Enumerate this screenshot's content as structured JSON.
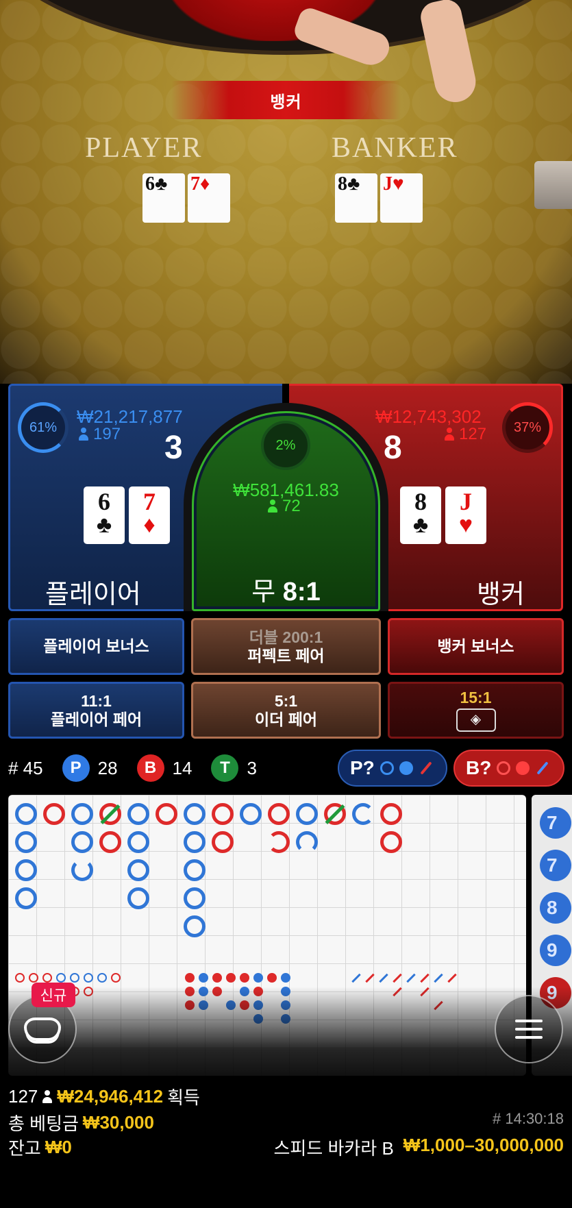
{
  "video": {
    "result_banner": "뱅커",
    "felt_player": "PLAYER",
    "felt_banker": "BANKER",
    "player_cards": [
      {
        "rank": "6",
        "suit": "♣",
        "color": "black"
      },
      {
        "rank": "7",
        "suit": "♦",
        "color": "red"
      }
    ],
    "banker_cards": [
      {
        "rank": "8",
        "suit": "♣",
        "color": "black"
      },
      {
        "rank": "J",
        "suit": "♥",
        "color": "red"
      }
    ]
  },
  "player": {
    "percent": "61%",
    "amount": "₩21,217,877",
    "bettors": "197",
    "score": "3",
    "label": "플레이어",
    "cards": [
      {
        "rank": "6",
        "suit": "♣"
      },
      {
        "rank": "7",
        "suit": "♦"
      }
    ]
  },
  "banker": {
    "percent": "37%",
    "amount": "₩12,743,302",
    "bettors": "127",
    "score": "8",
    "label": "뱅커",
    "cards": [
      {
        "rank": "8",
        "suit": "♣"
      },
      {
        "rank": "J",
        "suit": "♥"
      }
    ]
  },
  "tie": {
    "percent": "2%",
    "amount": "₩581,461.83",
    "bettors": "72",
    "label": "무",
    "odds": "8:1"
  },
  "side_bets": {
    "player_bonus": "플레이어 보너스",
    "perfect_pair_top": "더블 200:1",
    "perfect_pair_bottom": "퍼펙트 페어",
    "banker_bonus": "뱅커 보너스",
    "player_pair_odds": "11:1",
    "player_pair": "플레이어 페어",
    "either_pair_odds": "5:1",
    "either_pair": "이더 페어",
    "bonus_odds": "15:1"
  },
  "stats": {
    "round_label": "# 45",
    "p_label": "P",
    "p_count": "28",
    "b_label": "B",
    "b_count": "14",
    "t_label": "T",
    "t_count": "3",
    "predict_p": "P?",
    "predict_b": "B?"
  },
  "road_side_numbers": [
    "7",
    "7",
    "8",
    "9",
    "9"
  ],
  "buttons": {
    "new_badge": "신규"
  },
  "footer": {
    "players": "127",
    "win_amount": "₩24,946,412",
    "win_label": "획득",
    "total_bet_label": "총 베팅금",
    "total_bet": "₩30,000",
    "round_id": "# 14:30:18",
    "balance_label": "잔고",
    "balance": "₩0",
    "table_name": "스피드 바카라 B",
    "limits": "₩1,000–30,000,000"
  },
  "colors": {
    "player_blue": "#2f7ae5",
    "banker_red": "#e02424",
    "tie_green": "#1e8c3a",
    "gold": "#f5c41a"
  }
}
